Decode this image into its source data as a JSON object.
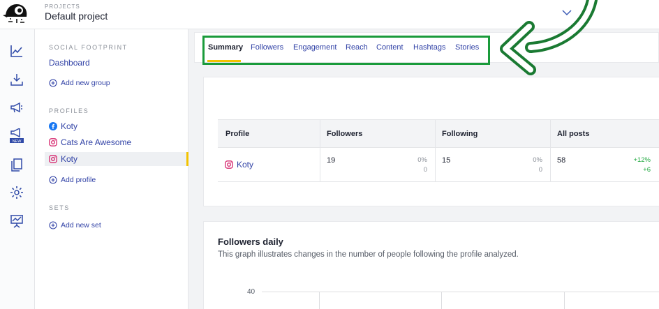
{
  "header": {
    "projects_label": "PROJECTS",
    "project_name": "Default project"
  },
  "rail": {
    "icons": [
      "chart-line-icon",
      "download-icon",
      "megaphone-icon",
      "megaphone-new-icon",
      "copy-icon",
      "gear-icon",
      "presentation-icon"
    ],
    "new_badge": "NEW"
  },
  "sidebar": {
    "social_footprint_title": "SOCIAL FOOTPRINT",
    "dashboard_link": "Dashboard",
    "add_group": "Add new group",
    "profiles_title": "PROFILES",
    "profiles": [
      {
        "name": "Koty",
        "network": "facebook"
      },
      {
        "name": "Cats Are Awesome",
        "network": "instagram"
      },
      {
        "name": "Koty",
        "network": "instagram"
      }
    ],
    "add_profile": "Add profile",
    "sets_title": "SETS",
    "add_set": "Add new set"
  },
  "tabs": [
    {
      "label": "Summary",
      "active": true
    },
    {
      "label": "Followers"
    },
    {
      "label": "Engagement"
    },
    {
      "label": "Reach"
    },
    {
      "label": "Content"
    },
    {
      "label": "Hashtags"
    },
    {
      "label": "Stories"
    }
  ],
  "summary_table": {
    "headers": [
      "Profile",
      "Followers",
      "Following",
      "All posts"
    ],
    "row": {
      "profile": "Koty",
      "followers": "19",
      "followers_pct": "0%",
      "followers_delta": "0",
      "following": "15",
      "following_pct": "0%",
      "following_delta": "0",
      "posts": "58",
      "posts_pct": "+12%",
      "posts_delta": "+6"
    }
  },
  "followers_daily": {
    "title": "Followers daily",
    "description": "This graph illustrates changes in the number of people following the profile analyzed.",
    "y_tick": "40"
  },
  "colors": {
    "accent_blue": "#3142a6",
    "active_yellow": "#f3c300",
    "highlight_green": "#1a9b3b",
    "positive_green": "#1fa83f",
    "facebook_blue": "#1877f2",
    "instagram_pink": "#d6286e"
  }
}
